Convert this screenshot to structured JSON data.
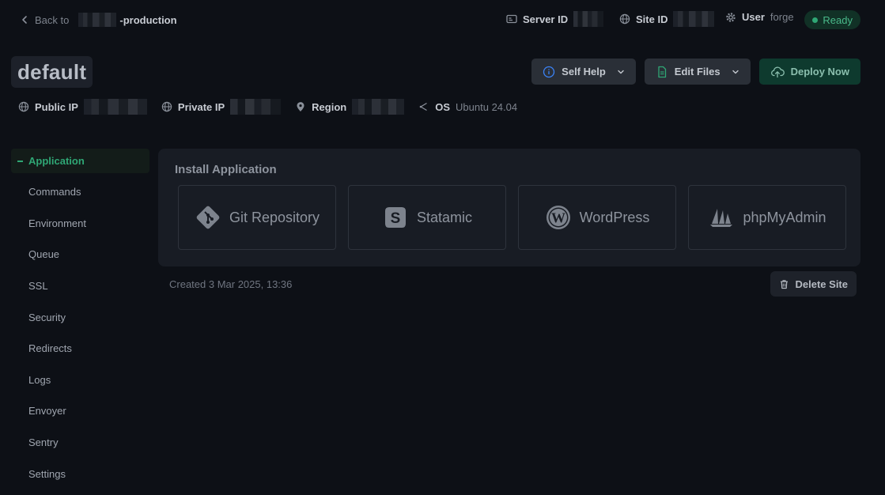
{
  "topbar": {
    "back_label": "Back to",
    "project_suffix": "-production",
    "server_id_label": "Server ID",
    "site_id_label": "Site ID",
    "user_label": "User",
    "user_value": "forge",
    "status": "Ready"
  },
  "header": {
    "site_name": "default",
    "self_help": "Self Help",
    "edit_files": "Edit Files",
    "deploy_now": "Deploy Now"
  },
  "info": {
    "public_ip_label": "Public IP",
    "private_ip_label": "Private IP",
    "region_label": "Region",
    "os_label": "OS",
    "os_value": "Ubuntu 24.04"
  },
  "sidebar": {
    "items": [
      {
        "label": "Application"
      },
      {
        "label": "Commands"
      },
      {
        "label": "Environment"
      },
      {
        "label": "Queue"
      },
      {
        "label": "SSL"
      },
      {
        "label": "Security"
      },
      {
        "label": "Redirects"
      },
      {
        "label": "Logs"
      },
      {
        "label": "Envoyer"
      },
      {
        "label": "Sentry"
      },
      {
        "label": "Settings"
      }
    ]
  },
  "main": {
    "install_title": "Install Application",
    "apps": [
      {
        "name": "Git Repository",
        "icon": "git-icon"
      },
      {
        "name": "Statamic",
        "icon": "statamic-icon"
      },
      {
        "name": "WordPress",
        "icon": "wordpress-icon"
      },
      {
        "name": "phpMyAdmin",
        "icon": "phpmyadmin-icon"
      }
    ],
    "created": "Created 3 Mar 2025, 13:36",
    "delete_label": "Delete Site"
  },
  "colors": {
    "accent": "#2fa775",
    "background": "#0d1016",
    "panel": "#181c24"
  }
}
